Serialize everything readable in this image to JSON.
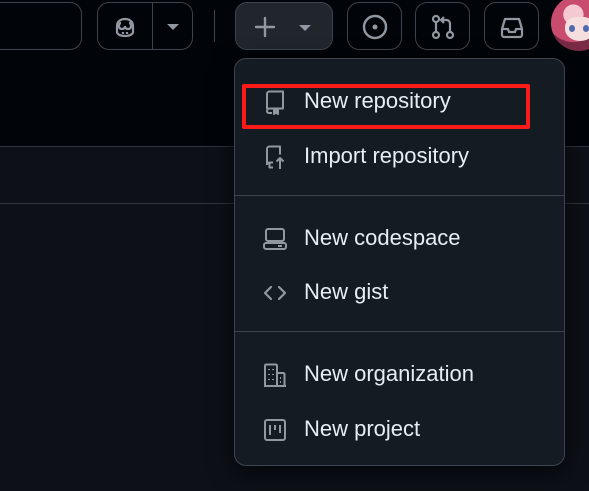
{
  "header": {
    "search_icon": "search-box-partial",
    "copilot_icon": "copilot-icon",
    "create_icon": "plus-icon",
    "issues_icon": "issue-circle-icon",
    "pulls_icon": "pull-request-icon",
    "inbox_icon": "inbox-icon",
    "avatar": "user-avatar"
  },
  "create_menu": {
    "items": [
      {
        "label": "New repository",
        "icon": "repo-icon",
        "highlighted": true
      },
      {
        "label": "Import repository",
        "icon": "repo-push-icon"
      },
      {
        "label": "New codespace",
        "icon": "codespaces-icon"
      },
      {
        "label": "New gist",
        "icon": "code-icon"
      },
      {
        "label": "New organization",
        "icon": "organization-icon"
      },
      {
        "label": "New project",
        "icon": "project-icon"
      }
    ]
  },
  "colors": {
    "background": "#0d1117",
    "menu_bg": "#151b23",
    "border": "#3d444d",
    "text": "#e6edf3",
    "muted_icon": "#9198a1",
    "highlight": "#ff1a1a"
  }
}
